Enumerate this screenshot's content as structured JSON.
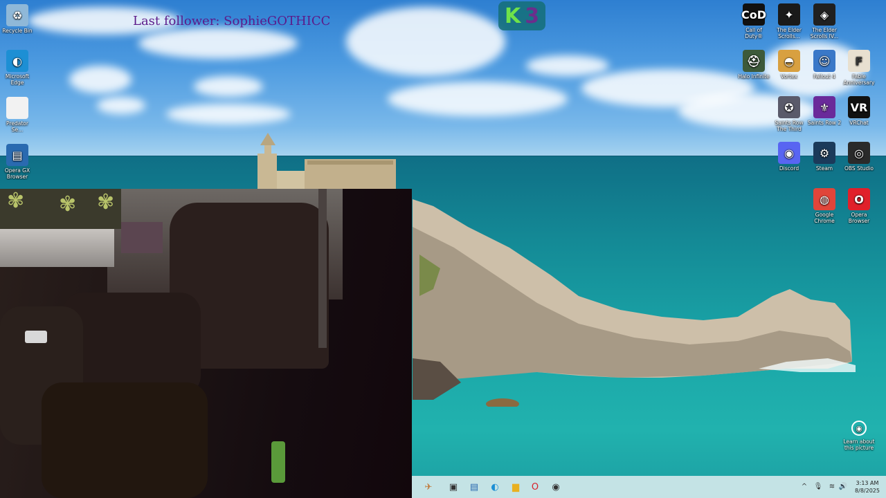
{
  "stream_overlay": {
    "follower_text": "Last follower: SophieGOTHICC",
    "logo": {
      "k": "K",
      "three": "3"
    }
  },
  "desktop_left": [
    {
      "label": "Recycle Bin",
      "icon": "recycle-bin-icon",
      "glyph": "♻",
      "color": "#8fb8d8"
    },
    {
      "label": "Microsoft Edge",
      "icon": "edge-icon",
      "glyph": "◐",
      "color": "#1d8fd4"
    },
    {
      "label": "Predator Se...",
      "icon": "file-icon",
      "glyph": "",
      "color": "#f2f2f2"
    },
    {
      "label": "Opera GX Browser",
      "icon": "opera-gx-shortcut-icon",
      "glyph": "▤",
      "color": "#2a6ab0"
    }
  ],
  "desktop_right": [
    {
      "label": "Call of Duty®",
      "icon": "call-of-duty-icon",
      "glyph": "CoD",
      "color": "#111111"
    },
    {
      "label": "The Elder Scrolls...",
      "icon": "elder-scrolls-icon",
      "glyph": "✦",
      "color": "#1a1a1a"
    },
    {
      "label": "The Elder Scrolls IV...",
      "icon": "oblivion-icon",
      "glyph": "◈",
      "color": "#202020"
    },
    {
      "label": "Halo Infinite",
      "icon": "halo-infinite-icon",
      "glyph": "⛑",
      "color": "#3d5a3a"
    },
    {
      "label": "Vortex",
      "icon": "vortex-icon",
      "glyph": "◓",
      "color": "#d8a040"
    },
    {
      "label": "Fallout 4",
      "icon": "fallout4-icon",
      "glyph": "☺",
      "color": "#3a78c8"
    },
    {
      "label": "Fable Anniversary",
      "icon": "fable-icon",
      "glyph": "F",
      "color": "#e8e0d0"
    },
    {
      "label": "Saints Row The Third",
      "icon": "saints-row-third-icon",
      "glyph": "✪",
      "color": "#5a5a6a"
    },
    {
      "label": "Saints Row 2",
      "icon": "saints-row-2-icon",
      "glyph": "⚜",
      "color": "#6a2a9a"
    },
    {
      "label": "VRChat",
      "icon": "vrchat-icon",
      "glyph": "VR",
      "color": "#111111"
    },
    {
      "label": "Discord",
      "icon": "discord-icon",
      "glyph": "◉",
      "color": "#5865f2"
    },
    {
      "label": "Steam",
      "icon": "steam-icon",
      "glyph": "⚙",
      "color": "#1b3a5a"
    },
    {
      "label": "OBS Studio",
      "icon": "obs-icon",
      "glyph": "◎",
      "color": "#2a2a2a"
    },
    {
      "label": "Google Chrome",
      "icon": "chrome-icon",
      "glyph": "◍",
      "color": "#e0453a"
    },
    {
      "label": "Opera Browser",
      "icon": "opera-icon",
      "glyph": "O",
      "color": "#e0202a"
    }
  ],
  "learn_picture": {
    "label": "Learn about this picture",
    "icon": "camera-icon"
  },
  "taskbar": {
    "apps": [
      {
        "name": "taskbar-app-game",
        "icon": "game-app-icon",
        "glyph": "✈",
        "color": "#c07a3a"
      },
      {
        "name": "taskbar-task-view",
        "icon": "task-view-icon",
        "glyph": "▣",
        "color": "#333333"
      },
      {
        "name": "taskbar-opera-gx",
        "icon": "window-app-icon",
        "glyph": "▤",
        "color": "#2a6ab0"
      },
      {
        "name": "taskbar-edge",
        "icon": "edge-icon",
        "glyph": "◐",
        "color": "#1d8fd4"
      },
      {
        "name": "taskbar-file-explorer",
        "icon": "folder-icon",
        "glyph": "▆",
        "color": "#e8b020"
      },
      {
        "name": "taskbar-opera",
        "icon": "opera-icon",
        "glyph": "O",
        "color": "#d8202a"
      },
      {
        "name": "taskbar-obs",
        "icon": "obs-icon",
        "glyph": "◉",
        "color": "#333333"
      }
    ],
    "tray": {
      "chevron": "^",
      "mic": "🎙",
      "wifi": "≋",
      "volume": "🔊"
    },
    "clock": {
      "time": "3:13 AM",
      "date": "8/8/2025"
    }
  }
}
